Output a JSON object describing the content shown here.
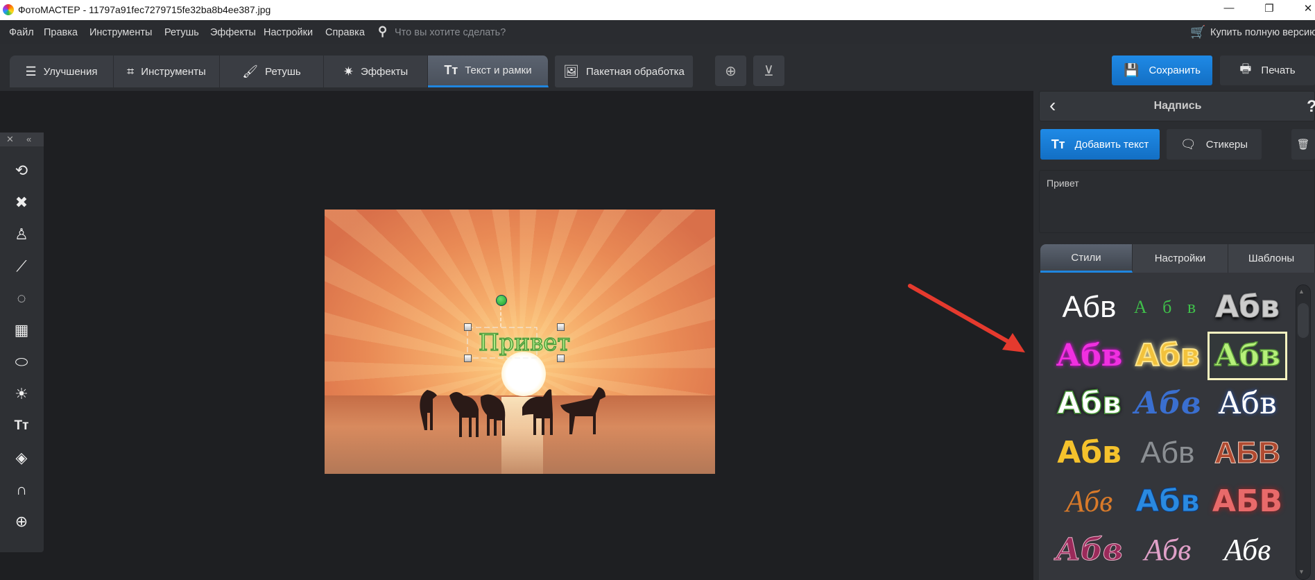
{
  "window": {
    "title": "ФотоМАСТЕР - 11797a91fec7279715fe32ba8b4ee387.jpg",
    "minimize": "—",
    "maximize": "❐",
    "close": "✕"
  },
  "menu": {
    "items": [
      "Файл",
      "Правка",
      "Инструменты",
      "Ретушь",
      "Эффекты",
      "Настройки",
      "Справка"
    ],
    "search_placeholder": "Что вы хотите сделать?",
    "buy": "Купить полную версию"
  },
  "tabs": [
    {
      "label": "Улучшения",
      "icon": "sliders-icon"
    },
    {
      "label": "Инструменты",
      "icon": "crop-icon"
    },
    {
      "label": "Ретушь",
      "icon": "brush-icon"
    },
    {
      "label": "Эффекты",
      "icon": "magic-wand-icon"
    },
    {
      "label": "Текст и рамки",
      "icon": "text-icon",
      "active": true
    }
  ],
  "batch": {
    "label": "Пакетная обработка"
  },
  "actions": {
    "save": "Сохранить",
    "print": "Печать"
  },
  "panel": {
    "title": "Надпись",
    "back": "‹",
    "help": "?",
    "add_text": "Добавить текст",
    "stickers": "Стикеры",
    "text_value": "Привет",
    "tabs": [
      "Стили",
      "Настройки",
      "Шаблоны"
    ],
    "active_tab": "Стили",
    "styles": [
      "Абв",
      "А б в",
      "Абв",
      "Абв",
      "Абв",
      "Абв",
      "Абв",
      "Абв",
      "Абв",
      "Абв",
      "Абв",
      "АБВ",
      "Абв",
      "Абв",
      "АБВ",
      "Абв",
      "Абв",
      "Абв"
    ],
    "selected_style": 5
  },
  "canvas": {
    "overlay_text": "Привет"
  },
  "colors": {
    "accent": "#1f86e0",
    "selection": "#f6f3c0"
  }
}
